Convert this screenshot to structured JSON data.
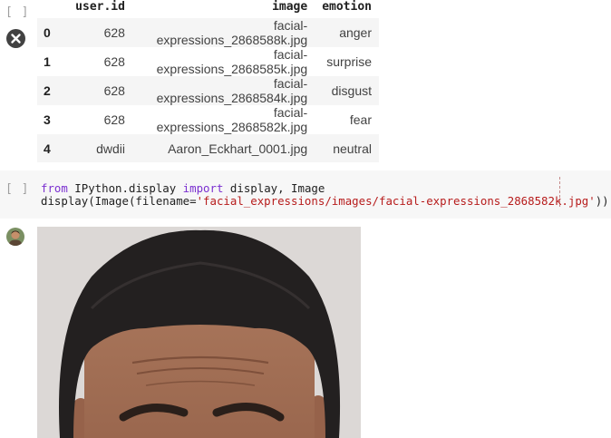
{
  "dataframe_cell": {
    "bracket": "[ ]",
    "columns": [
      "",
      "user.id",
      "image",
      "emotion"
    ],
    "rows": [
      {
        "index": "0",
        "user_id": "628",
        "image": "facial-expressions_2868588k.jpg",
        "emotion": "anger"
      },
      {
        "index": "1",
        "user_id": "628",
        "image": "facial-expressions_2868585k.jpg",
        "emotion": "surprise"
      },
      {
        "index": "2",
        "user_id": "628",
        "image": "facial-expressions_2868584k.jpg",
        "emotion": "disgust"
      },
      {
        "index": "3",
        "user_id": "628",
        "image": "facial-expressions_2868582k.jpg",
        "emotion": "fear"
      },
      {
        "index": "4",
        "user_id": "dwdii",
        "image": "Aaron_Eckhart_0001.jpg",
        "emotion": "neutral"
      }
    ]
  },
  "code_cell": {
    "bracket": "[ ]",
    "line1": {
      "kw_from": "from",
      "module": " IPython.display ",
      "kw_import": "import",
      "names": " display, Image"
    },
    "line2": {
      "prefix": "display(Image(filename=",
      "string": "'facial_expressions/images/facial-expressions_2868582k.jpg'",
      "suffix": "))"
    }
  },
  "icons": {
    "clear_output": "close-icon",
    "avatar": "user-avatar-icon"
  },
  "colors": {
    "keyword": "#7b30d0",
    "string": "#b71c1c",
    "row_stripe": "#f5f5f5",
    "code_bg": "#f7f7f7"
  }
}
